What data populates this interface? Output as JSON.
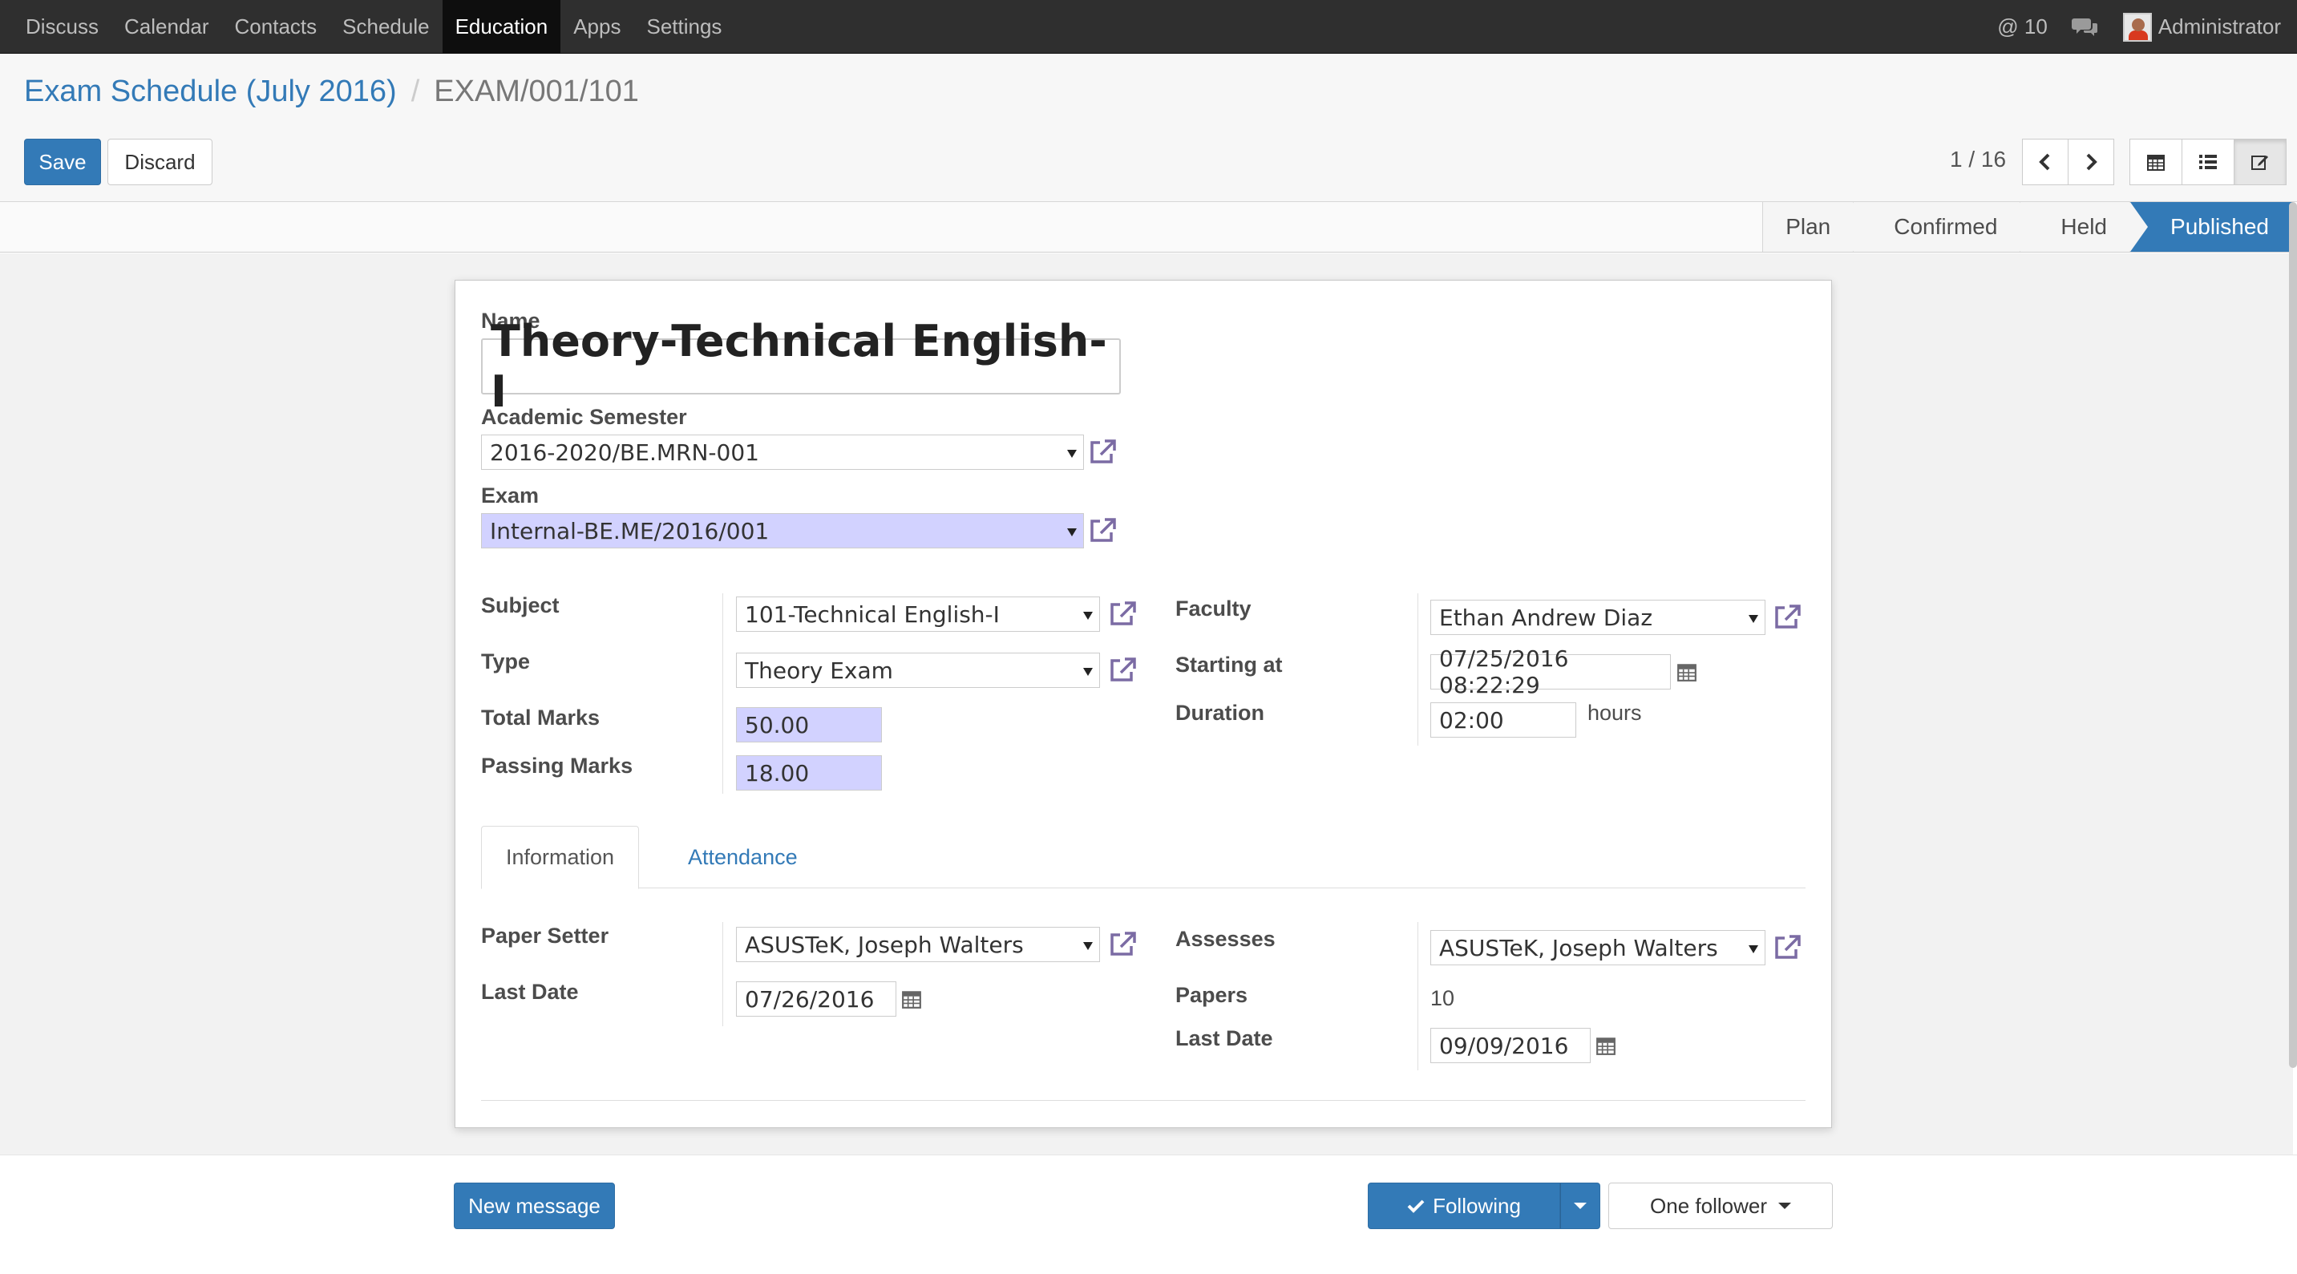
{
  "navbar": {
    "menus": [
      "Discuss",
      "Calendar",
      "Contacts",
      "Schedule",
      "Education",
      "Apps",
      "Settings"
    ],
    "mentions": "@ 10",
    "user": "Administrator"
  },
  "breadcrumb": {
    "parent": "Exam Schedule (July 2016)",
    "separator": "/",
    "current": "EXAM/001/101"
  },
  "buttons": {
    "save": "Save",
    "discard": "Discard"
  },
  "pager": {
    "value": "1 / 16"
  },
  "stages": [
    {
      "label": "Plan",
      "current": false
    },
    {
      "label": "Confirmed",
      "current": false
    },
    {
      "label": "Held",
      "current": false
    },
    {
      "label": "Published",
      "current": true
    }
  ],
  "form": {
    "name_label": "Name",
    "name_value": "Theory-Technical English-I",
    "semester_label": "Academic Semester",
    "semester_value": "2016-2020/BE.MRN-001",
    "exam_label": "Exam",
    "exam_value": "Internal-BE.ME/2016/001",
    "subject_label": "Subject",
    "subject_value": "101-Technical English-I",
    "type_label": "Type",
    "type_value": "Theory Exam",
    "total_marks_label": "Total Marks",
    "total_marks_value": "50.00",
    "passing_marks_label": "Passing Marks",
    "passing_marks_value": "18.00",
    "faculty_label": "Faculty",
    "faculty_value": "Ethan Andrew Diaz",
    "starting_label": "Starting at",
    "starting_value": "07/25/2016 08:22:29",
    "duration_label": "Duration",
    "duration_value": "02:00",
    "duration_unit": "hours"
  },
  "tabs": {
    "information": "Information",
    "attendance": "Attendance"
  },
  "info": {
    "paper_setter_label": "Paper Setter",
    "paper_setter_value": "ASUSTeK, Joseph Walters",
    "last_date_label": "Last Date",
    "last_date_value": "07/26/2016",
    "assesses_label": "Assesses",
    "assesses_value": "ASUSTeK, Joseph Walters",
    "papers_label": "Papers",
    "papers_value": "10",
    "last_date2_label": "Last Date",
    "last_date2_value": "09/09/2016"
  },
  "chatter": {
    "new_message": "New message",
    "following": "Following",
    "followers": "One follower"
  },
  "colors": {
    "primary": "#337ab7",
    "navbar": "#2f2f2f",
    "required_field": "#d2d2ff",
    "ext_link": "#7b6ba4"
  }
}
